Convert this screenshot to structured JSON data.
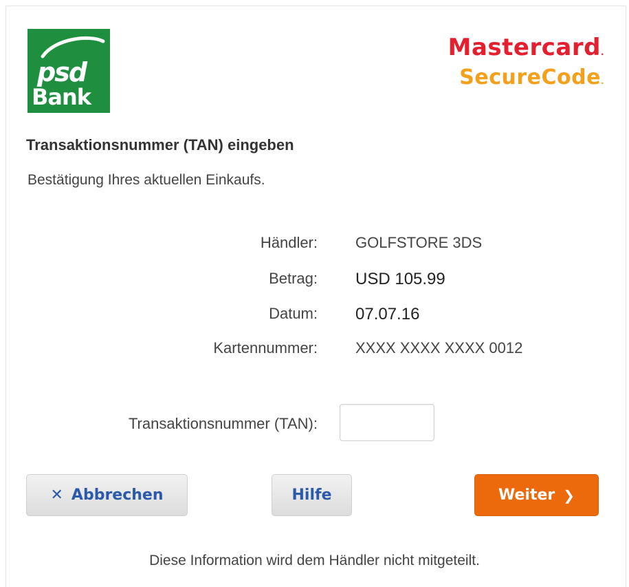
{
  "logo": {
    "word": "Bank",
    "mark": "psd",
    "color": "#1e8f3e"
  },
  "brand": {
    "line1": "Mastercard",
    "line2": "SecureCode",
    "line1_color": "#e4202f",
    "line2_color": "#f4a01c"
  },
  "title": "Transaktionsnummer (TAN) eingeben",
  "subtitle": "Bestätigung Ihres aktuellen Einkaufs.",
  "details": [
    {
      "label": "Händler:",
      "value": "GOLFSTORE 3DS"
    },
    {
      "label": "Betrag:",
      "value": "USD 105.99"
    },
    {
      "label": "Datum:",
      "value": "07.07.16"
    },
    {
      "label": "Kartennummer:",
      "value": "XXXX XXXX XXXX 0012"
    }
  ],
  "tan": {
    "label": "Transaktionsnummer (TAN):",
    "value": "",
    "placeholder": ""
  },
  "buttons": {
    "cancel": {
      "label": "Abbrechen",
      "icon": "close-icon"
    },
    "help": {
      "label": "Hilfe"
    },
    "next": {
      "label": "Weiter",
      "icon": "chevron-right-icon",
      "color": "#ec6a0c"
    }
  },
  "footer": "Diese Information wird dem Händler nicht mitgeteilt."
}
